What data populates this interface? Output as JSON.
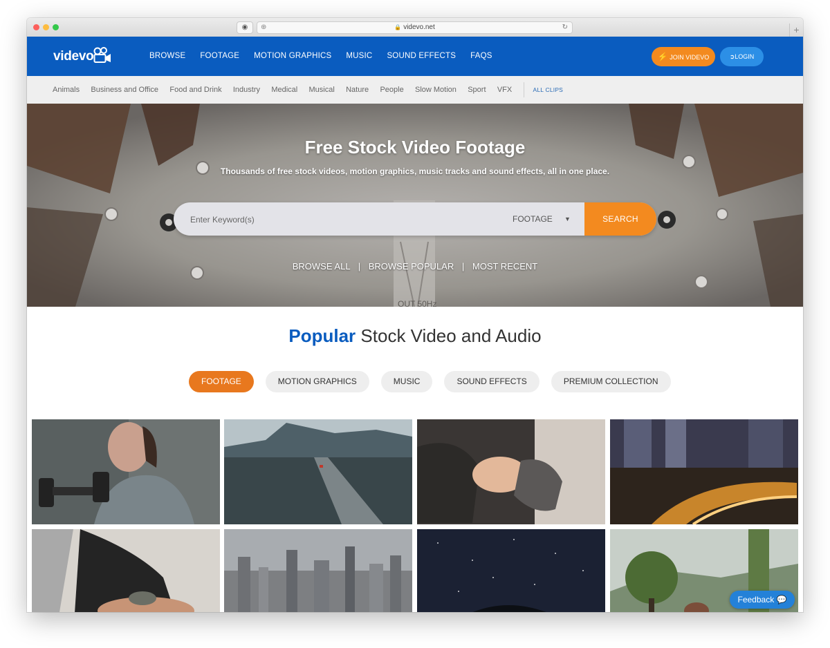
{
  "browser": {
    "url": "videvo.net"
  },
  "header": {
    "logo": "videvo",
    "nav": [
      "BROWSE",
      "FOOTAGE",
      "MOTION GRAPHICS",
      "MUSIC",
      "SOUND EFFECTS",
      "FAQS"
    ],
    "join_label": "JOIN VIDEVO",
    "login_label": "LOGIN",
    "brand_color": "#0a5cbf",
    "accent_color": "#f38a1f"
  },
  "categories": {
    "items": [
      "Animals",
      "Business and Office",
      "Food and Drink",
      "Industry",
      "Medical",
      "Musical",
      "Nature",
      "People",
      "Slow Motion",
      "Sport",
      "VFX"
    ],
    "all_label": "ALL CLIPS"
  },
  "hero": {
    "title": "Free Stock Video Footage",
    "subtitle": "Thousands of free stock videos, motion graphics, music tracks and sound effects, all in one place.",
    "search_placeholder": "Enter Keyword(s)",
    "search_type": "FOOTAGE",
    "search_button": "SEARCH",
    "links": [
      "BROWSE ALL",
      "BROWSE POPULAR",
      "MOST RECENT"
    ],
    "reel_text": "OUT 50Hz"
  },
  "popular": {
    "heading_accent": "Popular",
    "heading_rest": "Stock Video and Audio",
    "tabs": [
      "FOOTAGE",
      "MOTION GRAPHICS",
      "MUSIC",
      "SOUND EFFECTS",
      "PREMIUM COLLECTION"
    ],
    "active_tab": "FOOTAGE"
  },
  "feedback": {
    "label": "Feedback"
  }
}
